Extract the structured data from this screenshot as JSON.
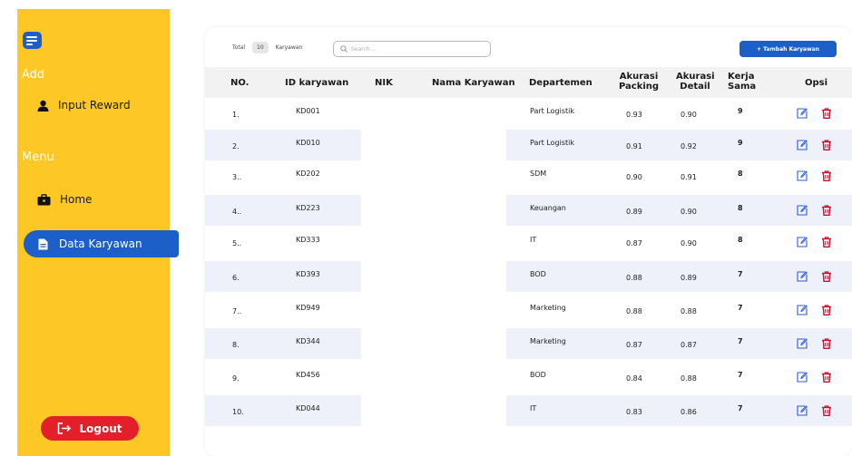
{
  "sidebar": {
    "add_heading": "Add",
    "input_reward": "Input Reward",
    "menu_heading": "Menu",
    "home": "Home",
    "data_karyawan": "Data Karyawan",
    "logout": "Logout",
    "colors": {
      "background": "#FDC825",
      "active": "#1D5FC8",
      "logout": "#E3202A"
    }
  },
  "toolbar": {
    "total_label": "Total",
    "total_count": "10",
    "total_unit": "Karyawan",
    "search_placeholder": "Search...",
    "add_button": "+ Tambah Karyawan"
  },
  "table": {
    "headers": {
      "no": "NO.",
      "id": "ID karyawan",
      "nik": "NIK",
      "nama": "Nama Karyawan",
      "departemen": "Departemen",
      "akurasi_packing": "Akurasi Packing",
      "akurasi_detail": "Akurasi Detail",
      "kerja_sama": "Kerja Sama",
      "opsi": "Opsi"
    },
    "rows": [
      {
        "no": "1.",
        "id": "KD001",
        "departemen": "Part Logistik",
        "packing": "0.93",
        "detail": "0.90",
        "kerja": "9"
      },
      {
        "no": "2.",
        "id": "KD010",
        "departemen": "Part Logistik",
        "packing": "0.91",
        "detail": "0.92",
        "kerja": "9"
      },
      {
        "no": "3..",
        "id": "KD202",
        "departemen": "SDM",
        "packing": "0.90",
        "detail": "0.91",
        "kerja": "8"
      },
      {
        "no": "4..",
        "id": "KD223",
        "departemen": "Keuangan",
        "packing": "0.89",
        "detail": "0.90",
        "kerja": "8"
      },
      {
        "no": "5..",
        "id": "KD333",
        "departemen": "IT",
        "packing": "0.87",
        "detail": "0.90",
        "kerja": "8"
      },
      {
        "no": "6.",
        "id": "KD393",
        "departemen": "BOD",
        "packing": "0.88",
        "detail": "0.89",
        "kerja": "7"
      },
      {
        "no": "7..",
        "id": "KD949",
        "departemen": "Marketing",
        "packing": "0.88",
        "detail": "0.88",
        "kerja": "7"
      },
      {
        "no": "8.",
        "id": "KD344",
        "departemen": "Marketing",
        "packing": "0.87",
        "detail": "0.87",
        "kerja": "7"
      },
      {
        "no": "9.",
        "id": "KD456",
        "departemen": "BOD",
        "packing": "0.84",
        "detail": "0.88",
        "kerja": "7"
      },
      {
        "no": "10.",
        "id": "KD044",
        "departemen": "IT",
        "packing": "0.83",
        "detail": "0.86",
        "kerja": "7"
      }
    ],
    "colors": {
      "edit": "#2D5CD6",
      "delete": "#C8102E",
      "stripe": "#EEF0FA",
      "header": "#F2F2F2"
    }
  }
}
